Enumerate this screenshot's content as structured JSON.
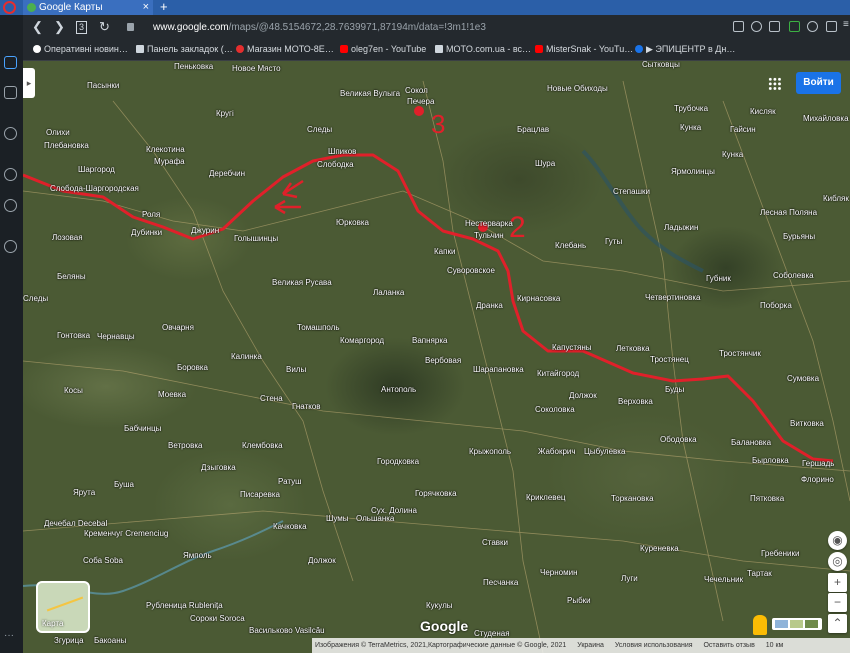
{
  "browser": {
    "tab_title": "Google Карты",
    "tab_close": "×",
    "new_tab": "+",
    "nav": {
      "back": "❮",
      "forward": "❯",
      "tabs_overview": "3",
      "reload": "↻"
    },
    "url_host": "www.google.com",
    "url_path": "/maps/@48.5154672,28.7639971,87194m/data=!3m1!1e3",
    "bookmarks": [
      {
        "label": "Оперативні новин…",
        "color": "#ffffff"
      },
      {
        "label": "Панель закладок (…",
        "color": "#cfd6dd"
      },
      {
        "label": "Магазин МОТО-8Е…",
        "color": "#e52e2e"
      },
      {
        "label": "oleg7en - YouTube",
        "color": "#ff0000"
      },
      {
        "label": "MOTO.com.ua - вс…",
        "color": "#cfd6dd"
      },
      {
        "label": "MisterSnak - YouTu…",
        "color": "#ff0000"
      },
      {
        "label": "▶ ЭПИЦЕНТР в Дн…",
        "color": "#1a73e8"
      }
    ]
  },
  "map": {
    "signin_label": "Войти",
    "layers_label": "Карта",
    "google_logo": "Google",
    "zoom_in": "+",
    "zoom_out": "−",
    "expand": "⌃",
    "footer": [
      "Изображения © TerraMetrics, 2021,Картографические данные © Google, 2021",
      "Украина",
      "Условия использования",
      "Оставить отзыв",
      "10 км"
    ],
    "annotations": [
      "3",
      "2"
    ],
    "places": [
      {
        "name": "Пеньковка",
        "id": "p1"
      },
      {
        "name": "Новое Място",
        "id": "p2"
      },
      {
        "name": "Пасынки",
        "id": "p3"
      },
      {
        "name": "Великая Вулыга",
        "id": "p4"
      },
      {
        "name": "Сокол",
        "id": "p5"
      },
      {
        "name": "Печера",
        "id": "p6"
      },
      {
        "name": "Сытковцы",
        "id": "p7"
      },
      {
        "name": "Новые Обиходы",
        "id": "p8"
      },
      {
        "name": "Кругі",
        "id": "p9"
      },
      {
        "name": "Следы",
        "id": "p10"
      },
      {
        "name": "Олихи",
        "id": "p11"
      },
      {
        "name": "Плебановка",
        "id": "p12"
      },
      {
        "name": "Клекотина",
        "id": "p13"
      },
      {
        "name": "Мурафа",
        "id": "p14"
      },
      {
        "name": "Шаргород",
        "id": "p15"
      },
      {
        "name": "Деребчин",
        "id": "p16"
      },
      {
        "name": "Шпиков",
        "id": "p17"
      },
      {
        "name": "Слободка",
        "id": "p18"
      },
      {
        "name": "Брацлав",
        "id": "p19"
      },
      {
        "name": "Шура",
        "id": "p20"
      },
      {
        "name": "Трубочка",
        "id": "p21"
      },
      {
        "name": "Кунка",
        "id": "p22"
      },
      {
        "name": "Гайсин",
        "id": "p23"
      },
      {
        "name": "Кисляк",
        "id": "p24"
      },
      {
        "name": "Михайловка",
        "id": "p25"
      },
      {
        "name": "Кунка",
        "id": "p26"
      },
      {
        "name": "Ярмолинцы",
        "id": "p27"
      },
      {
        "name": "Слобода-Шаргородская",
        "id": "p28"
      },
      {
        "name": "Роля",
        "id": "p29"
      },
      {
        "name": "Дубинки",
        "id": "p30"
      },
      {
        "name": "Джурин",
        "id": "p31"
      },
      {
        "name": "Юрковка",
        "id": "p32"
      },
      {
        "name": "Нестерварка",
        "id": "p33"
      },
      {
        "name": "Тульчин",
        "id": "p34"
      },
      {
        "name": "Клебань",
        "id": "p35"
      },
      {
        "name": "Гуты",
        "id": "p36"
      },
      {
        "name": "Степашки",
        "id": "p37"
      },
      {
        "name": "Ладыжин",
        "id": "p38"
      },
      {
        "name": "Лесная Поляна",
        "id": "p39"
      },
      {
        "name": "Кибляк",
        "id": "p40"
      },
      {
        "name": "Бурьяны",
        "id": "p41"
      },
      {
        "name": "Лозовая",
        "id": "p42"
      },
      {
        "name": "Голышинцы",
        "id": "p43"
      },
      {
        "name": "Капки",
        "id": "p44"
      },
      {
        "name": "Суворовское",
        "id": "p45"
      },
      {
        "name": "Беляны",
        "id": "p46"
      },
      {
        "name": "Великая Русава",
        "id": "p47"
      },
      {
        "name": "Лаланка",
        "id": "p48"
      },
      {
        "name": "Дранка",
        "id": "p49"
      },
      {
        "name": "Кирнасовка",
        "id": "p50"
      },
      {
        "name": "Губник",
        "id": "p51"
      },
      {
        "name": "Четвертиновка",
        "id": "p52"
      },
      {
        "name": "Соболевка",
        "id": "p53"
      },
      {
        "name": "Поборка",
        "id": "p54"
      },
      {
        "name": "Следы",
        "id": "p55"
      },
      {
        "name": "Гонтовка",
        "id": "p56"
      },
      {
        "name": "Чернавцы",
        "id": "p57"
      },
      {
        "name": "Овчарня",
        "id": "p58"
      },
      {
        "name": "Томашполь",
        "id": "p59"
      },
      {
        "name": "Комаргород",
        "id": "p60"
      },
      {
        "name": "Вапнярка",
        "id": "p61"
      },
      {
        "name": "Капустяны",
        "id": "p62"
      },
      {
        "name": "Летковка",
        "id": "p63"
      },
      {
        "name": "Тростянец",
        "id": "p64"
      },
      {
        "name": "Тростянчик",
        "id": "p65"
      },
      {
        "name": "Калинка",
        "id": "p66"
      },
      {
        "name": "Вербовая",
        "id": "p67"
      },
      {
        "name": "Шарапановка",
        "id": "p68"
      },
      {
        "name": "Китайгород",
        "id": "p69"
      },
      {
        "name": "Буды",
        "id": "p70"
      },
      {
        "name": "Сумовка",
        "id": "p71"
      },
      {
        "name": "Боровка",
        "id": "p72"
      },
      {
        "name": "Вилы",
        "id": "p73"
      },
      {
        "name": "Антополь",
        "id": "p74"
      },
      {
        "name": "Должок",
        "id": "p75"
      },
      {
        "name": "Верховка",
        "id": "p76"
      },
      {
        "name": "Косы",
        "id": "p77"
      },
      {
        "name": "Моевка",
        "id": "p78"
      },
      {
        "name": "Стена",
        "id": "p79"
      },
      {
        "name": "Гнатков",
        "id": "p80"
      },
      {
        "name": "Соколовка",
        "id": "p81"
      },
      {
        "name": "Витковка",
        "id": "p82"
      },
      {
        "name": "Бабчинцы",
        "id": "p83"
      },
      {
        "name": "Ветровка",
        "id": "p84"
      },
      {
        "name": "Клембовка",
        "id": "p85"
      },
      {
        "name": "Крыжополь",
        "id": "p86"
      },
      {
        "name": "Жабокрич",
        "id": "p87"
      },
      {
        "name": "Цыбулевка",
        "id": "p88"
      },
      {
        "name": "Ободовка",
        "id": "p89"
      },
      {
        "name": "Балановка",
        "id": "p90"
      },
      {
        "name": "Бырловка",
        "id": "p91"
      },
      {
        "name": "Гершадь",
        "id": "p92"
      },
      {
        "name": "Дзыговка",
        "id": "p93"
      },
      {
        "name": "Городковка",
        "id": "p94"
      },
      {
        "name": "Флорино",
        "id": "p95"
      },
      {
        "name": "Буша",
        "id": "p96"
      },
      {
        "name": "Ратуш",
        "id": "p97"
      },
      {
        "name": "Ярута",
        "id": "p98"
      },
      {
        "name": "Писаревка",
        "id": "p99"
      },
      {
        "name": "Горячковка",
        "id": "p100"
      },
      {
        "name": "Криклевец",
        "id": "p101"
      },
      {
        "name": "Торкановка",
        "id": "p102"
      },
      {
        "name": "Пятковка",
        "id": "p103"
      },
      {
        "name": "Дечебал Decebal",
        "id": "p104"
      },
      {
        "name": "Кременчуг Cremenciug",
        "id": "p105"
      },
      {
        "name": "Качковка",
        "id": "p106"
      },
      {
        "name": "Сух. Долина",
        "id": "p107"
      },
      {
        "name": "Шумы",
        "id": "p108"
      },
      {
        "name": "Ольшанка",
        "id": "p109"
      },
      {
        "name": "Ставки",
        "id": "p110"
      },
      {
        "name": "Куреневка",
        "id": "p111"
      },
      {
        "name": "Соба Soba",
        "id": "p112"
      },
      {
        "name": "Ямполь",
        "id": "p113"
      },
      {
        "name": "Должок",
        "id": "p114"
      },
      {
        "name": "Гребеники",
        "id": "p115"
      },
      {
        "name": "Тартак",
        "id": "p116"
      },
      {
        "name": "Луги",
        "id": "p117"
      },
      {
        "name": "Песчанка",
        "id": "p118"
      },
      {
        "name": "Черномин",
        "id": "p119"
      },
      {
        "name": "Чечельник",
        "id": "p120"
      },
      {
        "name": "Рыбки",
        "id": "p121"
      },
      {
        "name": "Рубленица Rubleniţa",
        "id": "p122"
      },
      {
        "name": "Сороки Soroca",
        "id": "p123"
      },
      {
        "name": "Васильково Vasilcău",
        "id": "p124"
      },
      {
        "name": "Кукулы",
        "id": "p125"
      },
      {
        "name": "Студеная",
        "id": "p126"
      },
      {
        "name": "Згурица",
        "id": "p127"
      },
      {
        "name": "Бакоаны",
        "id": "p128"
      }
    ]
  },
  "colors": {
    "route": "#e0202a",
    "accent": "#1a73e8",
    "tabbar": "#2b5fa8"
  }
}
